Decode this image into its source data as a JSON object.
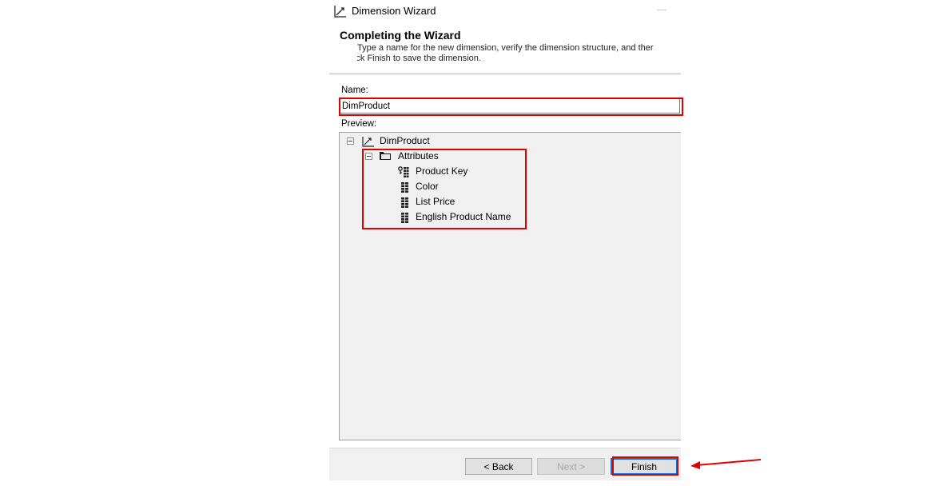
{
  "window": {
    "title": "Dimension Wizard"
  },
  "header": {
    "heading": "Completing the Wizard",
    "description_line1": "Type a name for the new dimension, verify the dimension structure, and ther",
    "description_line2": "click Finish to save the dimension."
  },
  "form": {
    "name_label": "Name:",
    "name_value": "DimProduct",
    "preview_label": "Preview:"
  },
  "tree": {
    "root": {
      "label": "DimProduct",
      "icon": "dimension-icon",
      "expanded": true
    },
    "folder": {
      "label": "Attributes",
      "icon": "folder-icon",
      "expanded": true
    },
    "attributes": [
      {
        "label": "Product Key",
        "icon": "key-attribute-icon"
      },
      {
        "label": "Color",
        "icon": "attribute-icon"
      },
      {
        "label": "List Price",
        "icon": "attribute-icon"
      },
      {
        "label": "English Product Name",
        "icon": "attribute-icon"
      }
    ]
  },
  "buttons": {
    "back": "< Back",
    "next": "Next >",
    "finish": "Finish"
  },
  "annotation_color": "#e00000"
}
